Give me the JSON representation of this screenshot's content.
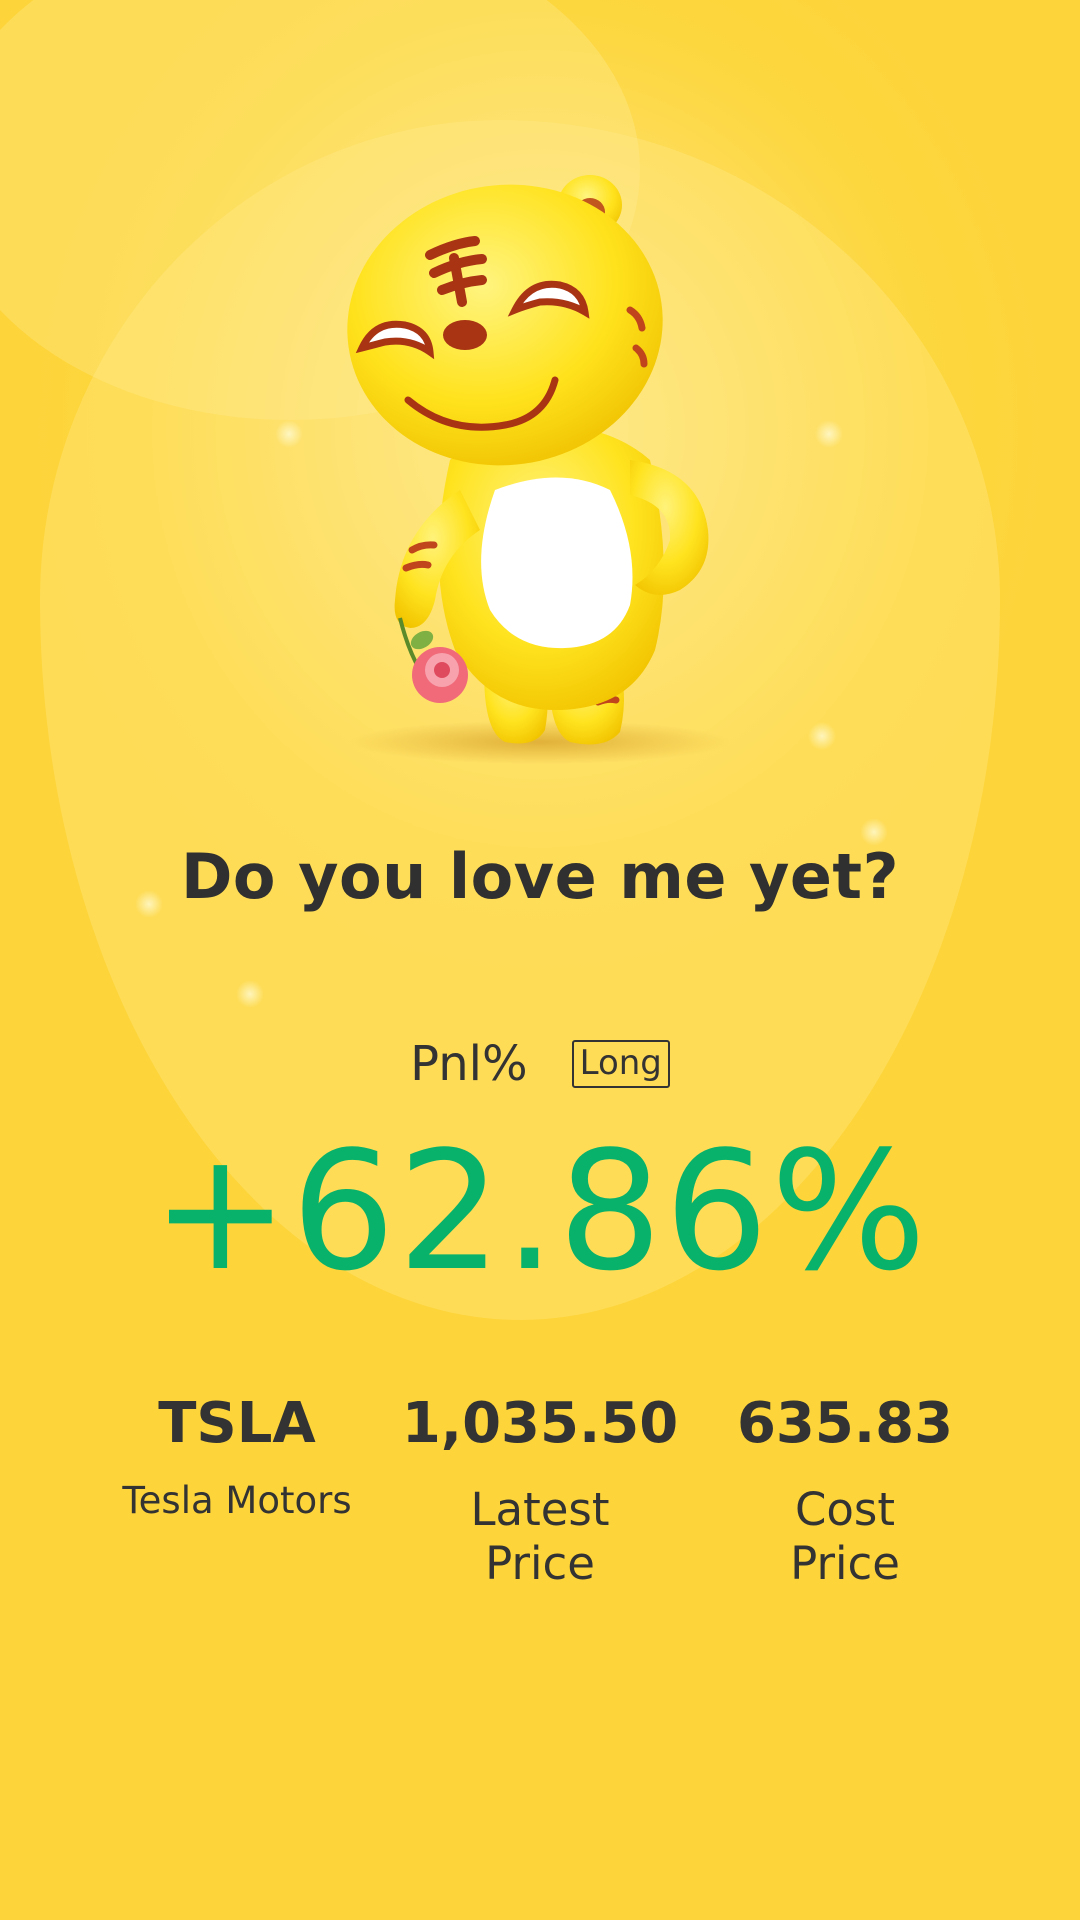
{
  "share_card": {
    "headline": "Do you love me yet?",
    "pnl_label": "Pnl%",
    "position_badge": "Long",
    "pnl_value": "+62.86%",
    "pnl_color": "#08b26a",
    "background_color": "#fdd73e",
    "mascot": "tiger-mascot-holding-flower"
  },
  "stats": [
    {
      "value": "TSLA",
      "label": "Tesla Motors"
    },
    {
      "value": "1,035.50",
      "label": "Latest\nPrice"
    },
    {
      "value": "635.83",
      "label": "Cost\nPrice"
    }
  ]
}
